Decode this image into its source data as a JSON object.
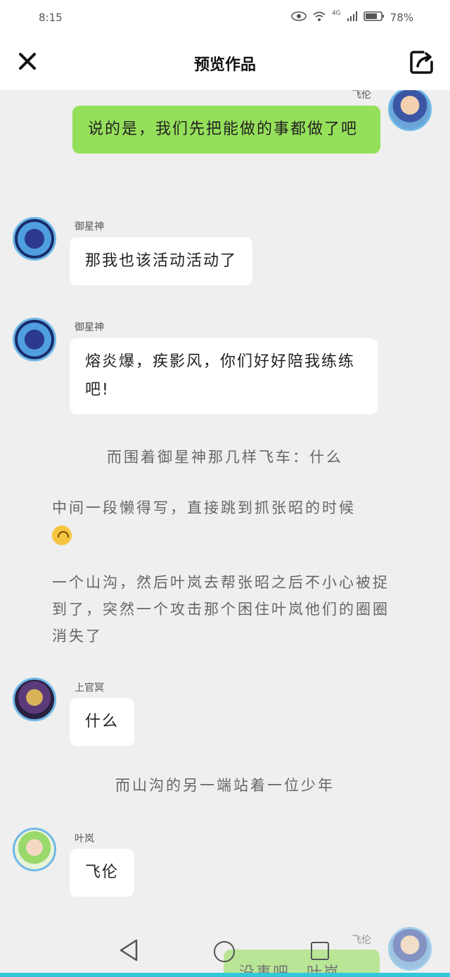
{
  "status": {
    "time": "8:15",
    "network": "4G",
    "battery": "78%"
  },
  "header": {
    "title": "预览作品"
  },
  "messages": [
    {
      "type": "right",
      "name": "飞伦",
      "text": "说的是，我们先把能做的事都做了吧"
    },
    {
      "type": "left",
      "name": "御星神",
      "text": "那我也该活动活动了"
    },
    {
      "type": "left",
      "name": "御星神",
      "text": "熔炎爆，疾影风，你们好好陪我练练吧!"
    },
    {
      "type": "narration",
      "text": "而围着御星神那几样飞车：什么"
    },
    {
      "type": "narration",
      "text": "中间一段懒得写，直接跳到抓张昭的时候"
    },
    {
      "type": "narration",
      "text": "一个山沟，然后叶岚去帮张昭之后不小心被捉到了，突然一个攻击那个困住叶岚他们的圈圈消失了"
    },
    {
      "type": "left",
      "name": "上官冥",
      "text": "什么"
    },
    {
      "type": "narration",
      "text": "而山沟的另一端站着一位少年"
    },
    {
      "type": "left",
      "name": "叶岚",
      "text": "飞伦"
    },
    {
      "type": "right",
      "name": "飞伦",
      "text": "没事吧，叶岚"
    }
  ],
  "colors": {
    "green_bubble": "#95e05a",
    "white_bubble": "#ffffff",
    "avatar_border": "#6fb8e8",
    "bottom_line": "#34c6d9"
  }
}
